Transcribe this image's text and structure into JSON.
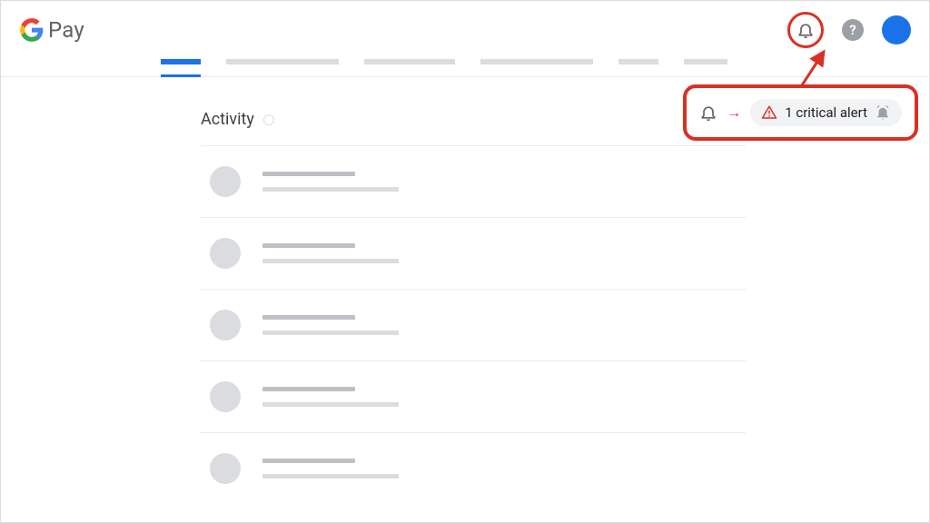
{
  "header": {
    "brand_text": "Pay"
  },
  "page": {
    "title": "Activity"
  },
  "callout": {
    "alert_text": "1 critical alert"
  },
  "colors": {
    "highlight": "#d93025",
    "primary": "#1a73e8",
    "grey": "#9aa0a6"
  }
}
